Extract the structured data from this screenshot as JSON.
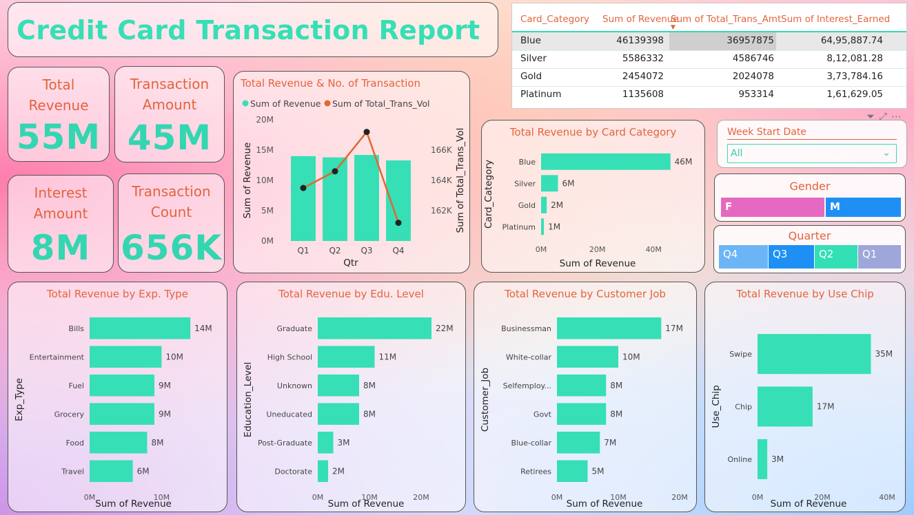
{
  "title": "Credit Card Transaction Report",
  "kpis": {
    "total_revenue": {
      "label": "Total Revenue",
      "value": "55M"
    },
    "transaction_amount": {
      "label": "Transaction Amount",
      "value": "45M"
    },
    "interest_amount": {
      "label": "Interest Amount",
      "value": "8M"
    },
    "transaction_count": {
      "label": "Transaction Count",
      "value": "656K"
    }
  },
  "table": {
    "headers": [
      "Card_Category",
      "Sum of Revenue",
      "Sum of Total_Trans_Amt",
      "Sum of Interest_Earned"
    ],
    "rows": [
      [
        "Blue",
        "46139398",
        "36957875",
        "64,95,887.74"
      ],
      [
        "Silver",
        "5586332",
        "4586746",
        "8,12,081.28"
      ],
      [
        "Gold",
        "2454072",
        "2024078",
        "3,73,784.16"
      ],
      [
        "Platinum",
        "1135608",
        "953314",
        "1,61,629.05"
      ]
    ]
  },
  "slicers": {
    "week": {
      "label": "Week Start Date",
      "value": "All"
    },
    "gender": {
      "label": "Gender",
      "options": [
        "F",
        "M"
      ]
    },
    "quarter": {
      "label": "Quarter",
      "options": [
        "Q4",
        "Q3",
        "Q2",
        "Q1"
      ]
    }
  },
  "colors": {
    "accent": "#36dfb5",
    "title_text": "#e2643d",
    "line": "#e0672f",
    "gender_f": "#e569c1",
    "gender_m": "#1e90f5"
  },
  "chart_data": [
    {
      "id": "revenue_transactions",
      "type": "bar",
      "title": "Total Revenue & No. of Transaction",
      "xlabel": "Qtr",
      "ylabel": "Sum of Revenue",
      "y2label": "Sum of Total_Trans_Vol",
      "categories": [
        "Q1",
        "Q2",
        "Q3",
        "Q4"
      ],
      "series": [
        {
          "name": "Sum of Revenue",
          "type": "bar",
          "values": [
            14000000,
            13800000,
            14200000,
            13300000
          ]
        },
        {
          "name": "Sum of Total_Trans_Vol",
          "type": "line",
          "axis": "right",
          "values": [
            163500,
            164600,
            167200,
            161200
          ]
        }
      ],
      "ylim": [
        0,
        20000000
      ],
      "yticks": [
        "0M",
        "5M",
        "10M",
        "15M",
        "20M"
      ],
      "y2ticks": [
        "162K",
        "164K",
        "166K"
      ],
      "legend": "top"
    },
    {
      "id": "card_category",
      "type": "bar",
      "orientation": "horizontal",
      "title": "Total Revenue by Card Category",
      "xlabel": "Sum of Revenue",
      "ylabel": "Card_Category",
      "categories": [
        "Blue",
        "Silver",
        "Gold",
        "Platinum"
      ],
      "values": [
        46,
        6,
        2,
        1
      ],
      "data_labels": [
        "46M",
        "6M",
        "2M",
        "1M"
      ],
      "xlim": [
        0,
        50
      ],
      "xticks": [
        "0M",
        "20M",
        "40M"
      ]
    },
    {
      "id": "exp_type",
      "type": "bar",
      "orientation": "horizontal",
      "title": "Total Revenue by Exp. Type",
      "xlabel": "Sum of Revenue",
      "ylabel": "Exp_Type",
      "categories": [
        "Bills",
        "Entertainment",
        "Fuel",
        "Grocery",
        "Food",
        "Travel"
      ],
      "values": [
        14,
        10,
        9,
        9,
        8,
        6
      ],
      "data_labels": [
        "14M",
        "10M",
        "9M",
        "9M",
        "8M",
        "6M"
      ],
      "xlim": [
        0,
        16
      ],
      "xticks": [
        "0M",
        "10M"
      ]
    },
    {
      "id": "edu_level",
      "type": "bar",
      "orientation": "horizontal",
      "title": "Total Revenue by Edu. Level",
      "xlabel": "Sum of Revenue",
      "ylabel": "Education_Level",
      "categories": [
        "Graduate",
        "High School",
        "Unknown",
        "Uneducated",
        "Post-Graduate",
        "Doctorate"
      ],
      "values": [
        22,
        11,
        8,
        8,
        3,
        2
      ],
      "data_labels": [
        "22M",
        "11M",
        "8M",
        "8M",
        "3M",
        "2M"
      ],
      "xlim": [
        0,
        24
      ],
      "xticks": [
        "0M",
        "10M",
        "20M"
      ]
    },
    {
      "id": "customer_job",
      "type": "bar",
      "orientation": "horizontal",
      "title": "Total Revenue by Customer Job",
      "xlabel": "Sum of Revenue",
      "ylabel": "Customer_Job",
      "categories": [
        "Businessman",
        "White-collar",
        "Selfemploy...",
        "Govt",
        "Blue-collar",
        "Retirees"
      ],
      "values": [
        17,
        10,
        8,
        8,
        7,
        5
      ],
      "data_labels": [
        "17M",
        "10M",
        "8M",
        "8M",
        "7M",
        "5M"
      ],
      "xlim": [
        0,
        20
      ],
      "xticks": [
        "0M",
        "10M",
        "20M"
      ]
    },
    {
      "id": "use_chip",
      "type": "bar",
      "orientation": "horizontal",
      "title": "Total Revenue by Use Chip",
      "xlabel": "Sum of Revenue",
      "ylabel": "Use_Chip",
      "categories": [
        "Swipe",
        "Chip",
        "Online"
      ],
      "values": [
        35,
        17,
        3
      ],
      "data_labels": [
        "35M",
        "17M",
        "3M"
      ],
      "xlim": [
        0,
        40
      ],
      "xticks": [
        "0M",
        "20M",
        "40M"
      ]
    }
  ]
}
